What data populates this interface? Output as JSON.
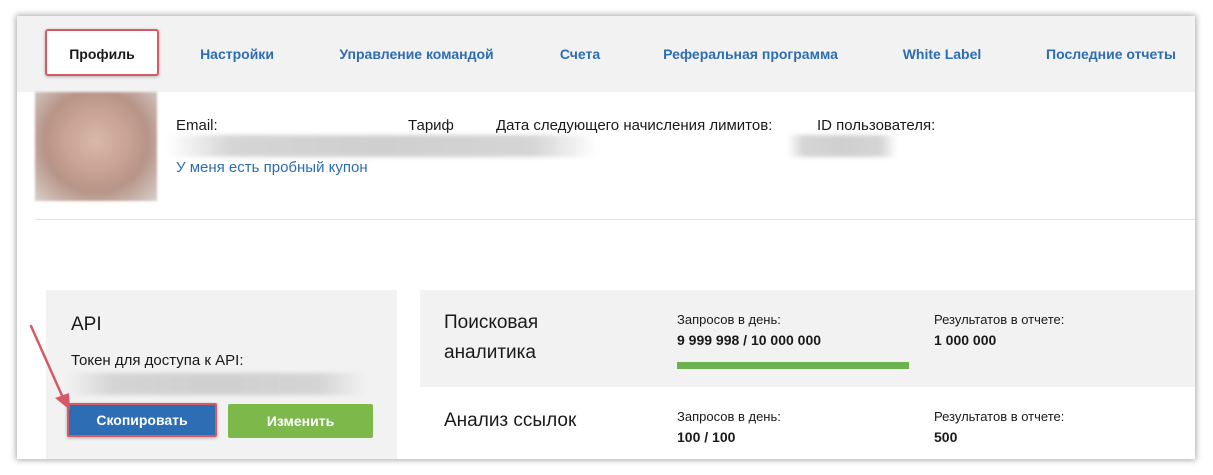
{
  "tabs": [
    {
      "label": "Профиль",
      "active": true
    },
    {
      "label": "Настройки"
    },
    {
      "label": "Управление командой"
    },
    {
      "label": "Счета"
    },
    {
      "label": "Реферальная программа"
    },
    {
      "label": "White Label"
    },
    {
      "label": "Последние отчеты"
    }
  ],
  "profile": {
    "email_label": "Email:",
    "tariff_label": "Тариф",
    "next_limits_label": "Дата следующего начисления лимитов:",
    "user_id_label": "ID пользователя:",
    "coupon_link": "У меня есть пробный купон"
  },
  "api": {
    "title": "API",
    "token_label": "Токен для доступа к API:",
    "copy_button": "Скопировать",
    "change_button": "Изменить"
  },
  "stats": [
    {
      "name": "Поисковая аналитика",
      "requests_label": "Запросов в день:",
      "requests_value": "9 999 998 / 10 000 000",
      "results_label": "Результатов в отчете:",
      "results_value": "1 000 000",
      "progress": 0.9999998
    },
    {
      "name": "Анализ ссылок",
      "requests_label": "Запросов в день:",
      "requests_value": "100 / 100",
      "results_label": "Результатов в отчете:",
      "results_value": "500"
    }
  ],
  "colors": {
    "link_blue": "#2d6db3",
    "copy_button": "#2d6db3",
    "change_button": "#7cb84a",
    "progress_fill": "#6cb251",
    "highlight_red": "#d45a66"
  }
}
